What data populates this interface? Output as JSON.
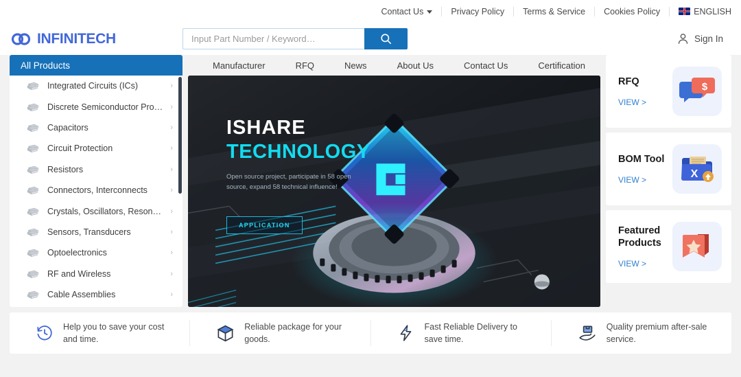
{
  "topbar": {
    "links": [
      {
        "label": "Contact Us",
        "icon": "chevron-down-icon",
        "has_caret": true
      },
      {
        "label": "Privacy Policy",
        "has_caret": false
      },
      {
        "label": "Terms & Service",
        "has_caret": false
      },
      {
        "label": "Cookies Policy",
        "has_caret": false
      }
    ],
    "language": "ENGLISH",
    "language_flag": "uk-flag-icon"
  },
  "header": {
    "logo_text": "INFINITECH",
    "logo_icon": "infinity-rings-icon",
    "search_placeholder": "Input Part Number / Keyword…",
    "search_value": "",
    "search_icon": "search-icon",
    "signin_label": "Sign In",
    "signin_icon": "user-icon"
  },
  "sidebar": {
    "header": "All Products",
    "items": [
      {
        "label": "Integrated Circuits (ICs)"
      },
      {
        "label": "Discrete Semiconductor Products"
      },
      {
        "label": "Capacitors"
      },
      {
        "label": "Circuit Protection"
      },
      {
        "label": "Resistors"
      },
      {
        "label": "Connectors, Interconnects"
      },
      {
        "label": "Crystals, Oscillators, Resonators"
      },
      {
        "label": "Sensors, Transducers"
      },
      {
        "label": "Optoelectronics"
      },
      {
        "label": "RF and Wireless"
      },
      {
        "label": "Cable Assemblies"
      }
    ]
  },
  "nav": {
    "items": [
      {
        "label": "Manufacturer"
      },
      {
        "label": "RFQ"
      },
      {
        "label": "News"
      },
      {
        "label": "About Us"
      },
      {
        "label": "Contact Us"
      },
      {
        "label": "Certification"
      }
    ]
  },
  "hero": {
    "title_line1": "ISHARE",
    "title_line2": "TECHNOLOGY",
    "subtitle": "Open source project, participate in 58 open source, expand 58 technical influence!",
    "button_label": "APPLICATION"
  },
  "cards": [
    {
      "title": "RFQ",
      "view_label": "VIEW >",
      "icon": "chat-bubbles-dollar-icon"
    },
    {
      "title": "BOM Tool",
      "view_label": "VIEW >",
      "icon": "folder-excel-upload-icon"
    },
    {
      "title": "Featured\nProducts",
      "view_label": "VIEW >",
      "icon": "bookmark-star-icon"
    }
  ],
  "features": [
    {
      "text": "Help you to save your cost and time.",
      "icon": "clock-rewind-icon"
    },
    {
      "text": "Reliable package for your goods.",
      "icon": "package-box-icon"
    },
    {
      "text": "Fast Reliable Delivery to save time.",
      "icon": "lightning-bolt-icon"
    },
    {
      "text": "Quality premium after-sale service.",
      "icon": "hand-holding-box-icon"
    }
  ],
  "colors": {
    "brand_blue": "#1771b8",
    "logo_blue": "#4267d8",
    "hero_cyan": "#12dcf0",
    "link_blue": "#2f7fd0",
    "page_bg": "#f2f2f2"
  }
}
